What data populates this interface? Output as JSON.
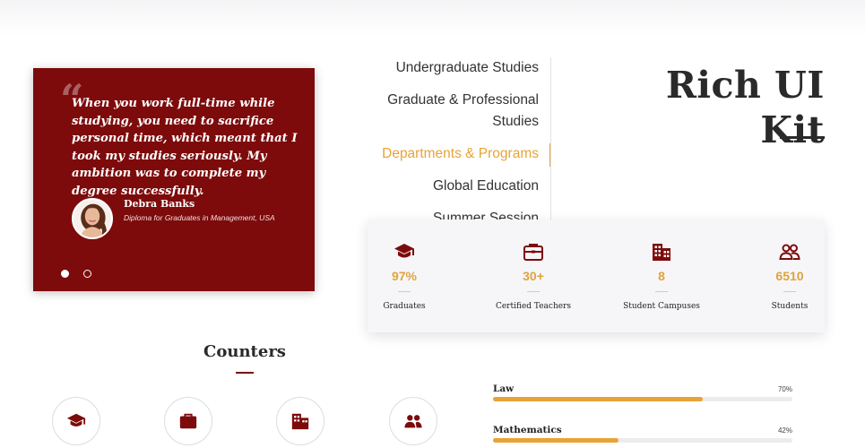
{
  "testimonial": {
    "quote": "When you work full-time while studying, you need to sacrifice personal time, which meant that I took my studies seriously. My ambition was to complete my degree successfully.",
    "author": "Debra Banks",
    "role": "Diploma for Graduates in Management, USA",
    "slides_total": 2,
    "active_slide": 1
  },
  "nav": {
    "items": [
      {
        "label": "Undergraduate Studies",
        "active": false
      },
      {
        "label": "Graduate & Professional Studies",
        "active": false
      },
      {
        "label": "Departments & Programs",
        "active": true
      },
      {
        "label": "Global Education",
        "active": false
      },
      {
        "label": "Summer Session",
        "active": false
      }
    ],
    "active_color": "#e7a336"
  },
  "title": "Rich UI Kit",
  "stats": [
    {
      "icon": "graduation-cap-icon",
      "value": "97%",
      "label": "Graduates"
    },
    {
      "icon": "briefcase-icon",
      "value": "30+",
      "label": "Certified Teachers"
    },
    {
      "icon": "building-icon",
      "value": "8",
      "label": "Student Campuses"
    },
    {
      "icon": "users-icon",
      "value": "6510",
      "label": "Students"
    }
  ],
  "counters": {
    "title": "Counters",
    "icons": [
      "graduation-cap-icon",
      "briefcase-icon",
      "building-icon",
      "users-icon"
    ]
  },
  "progress": [
    {
      "label": "Law",
      "percent_text": "70%",
      "value": 70
    },
    {
      "label": "Mathematics",
      "percent_text": "42%",
      "value": 42
    }
  ],
  "colors": {
    "brand": "#7d0b0b",
    "accent": "#e7a336",
    "text": "#2a2a2a"
  }
}
